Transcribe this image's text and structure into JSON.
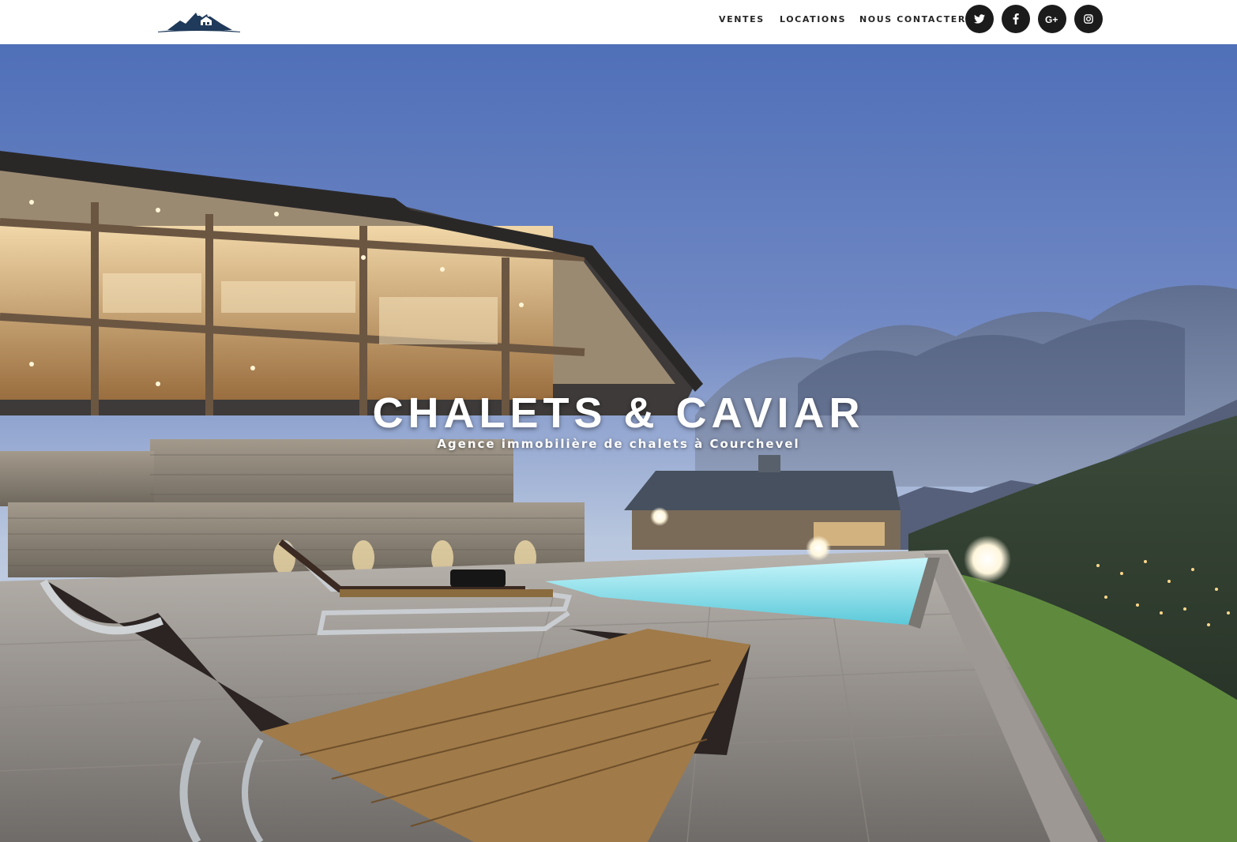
{
  "header": {
    "logo_icon": "mountain-chalet-logo-icon",
    "nav": {
      "ventes": "VENTES",
      "locations": "LOCATIONS",
      "contact": "NOUS CONTACTER"
    },
    "social": [
      {
        "icon": "twitter-icon"
      },
      {
        "icon": "facebook-icon"
      },
      {
        "icon": "google-plus-icon"
      },
      {
        "icon": "instagram-icon"
      }
    ]
  },
  "hero": {
    "title": "CHALETS & CAVIAR",
    "tagline": "Agence immobilière de chalets à Courchevel",
    "background": "photo of a luxury wooden chalet with illuminated infinity pool and sun loungers at dusk, mountain valley village in the background"
  },
  "colors": {
    "nav_text": "#262626",
    "social_bg": "#1b1b1b",
    "logo": "#1f3a5a",
    "sky_top": "#4f6fb8",
    "sky_horizon": "#b8c6de",
    "pool": "#8fe4ee"
  }
}
